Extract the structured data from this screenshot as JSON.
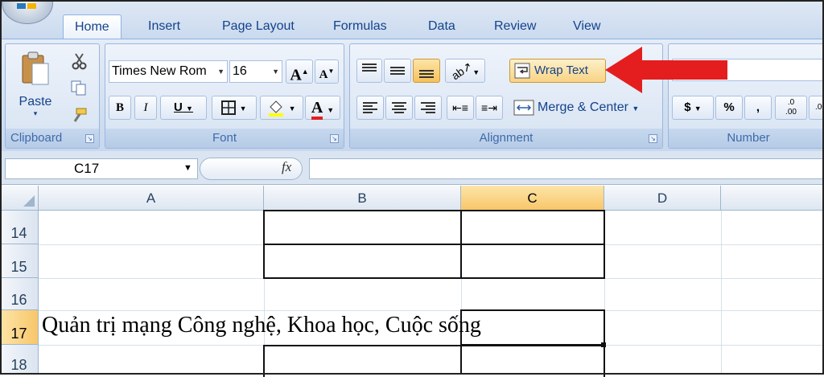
{
  "tabs": [
    "Home",
    "Insert",
    "Page Layout",
    "Formulas",
    "Data",
    "Review",
    "View"
  ],
  "active_tab": "Home",
  "clipboard": {
    "paste_label": "Paste",
    "group_label": "Clipboard"
  },
  "font": {
    "name": "Times New Rom",
    "size": "16",
    "group_label": "Font",
    "bold": "B",
    "italic": "I",
    "underline": "U",
    "grow": "A",
    "shrink": "A",
    "font_color": "A"
  },
  "alignment": {
    "wrap_text": "Wrap Text",
    "merge_center": "Merge & Center",
    "group_label": "Alignment"
  },
  "number": {
    "currency": "$",
    "percent": "%",
    "comma": ",",
    "inc_decimal": ".0\n.00",
    "group_label": "Number"
  },
  "name_box": "C17",
  "fx": "fx",
  "columns": [
    "A",
    "B",
    "C",
    "D"
  ],
  "selected_column": "C",
  "rows": [
    "14",
    "15",
    "16",
    "17",
    "18"
  ],
  "selected_row": "17",
  "cell_text": "Quản trị mạng Công nghệ, Khoa học, Cuộc sống",
  "colors": {
    "arrow": "#e41e1e",
    "selected_header": "#f8c66a",
    "ribbon": "#dbe6f4"
  }
}
